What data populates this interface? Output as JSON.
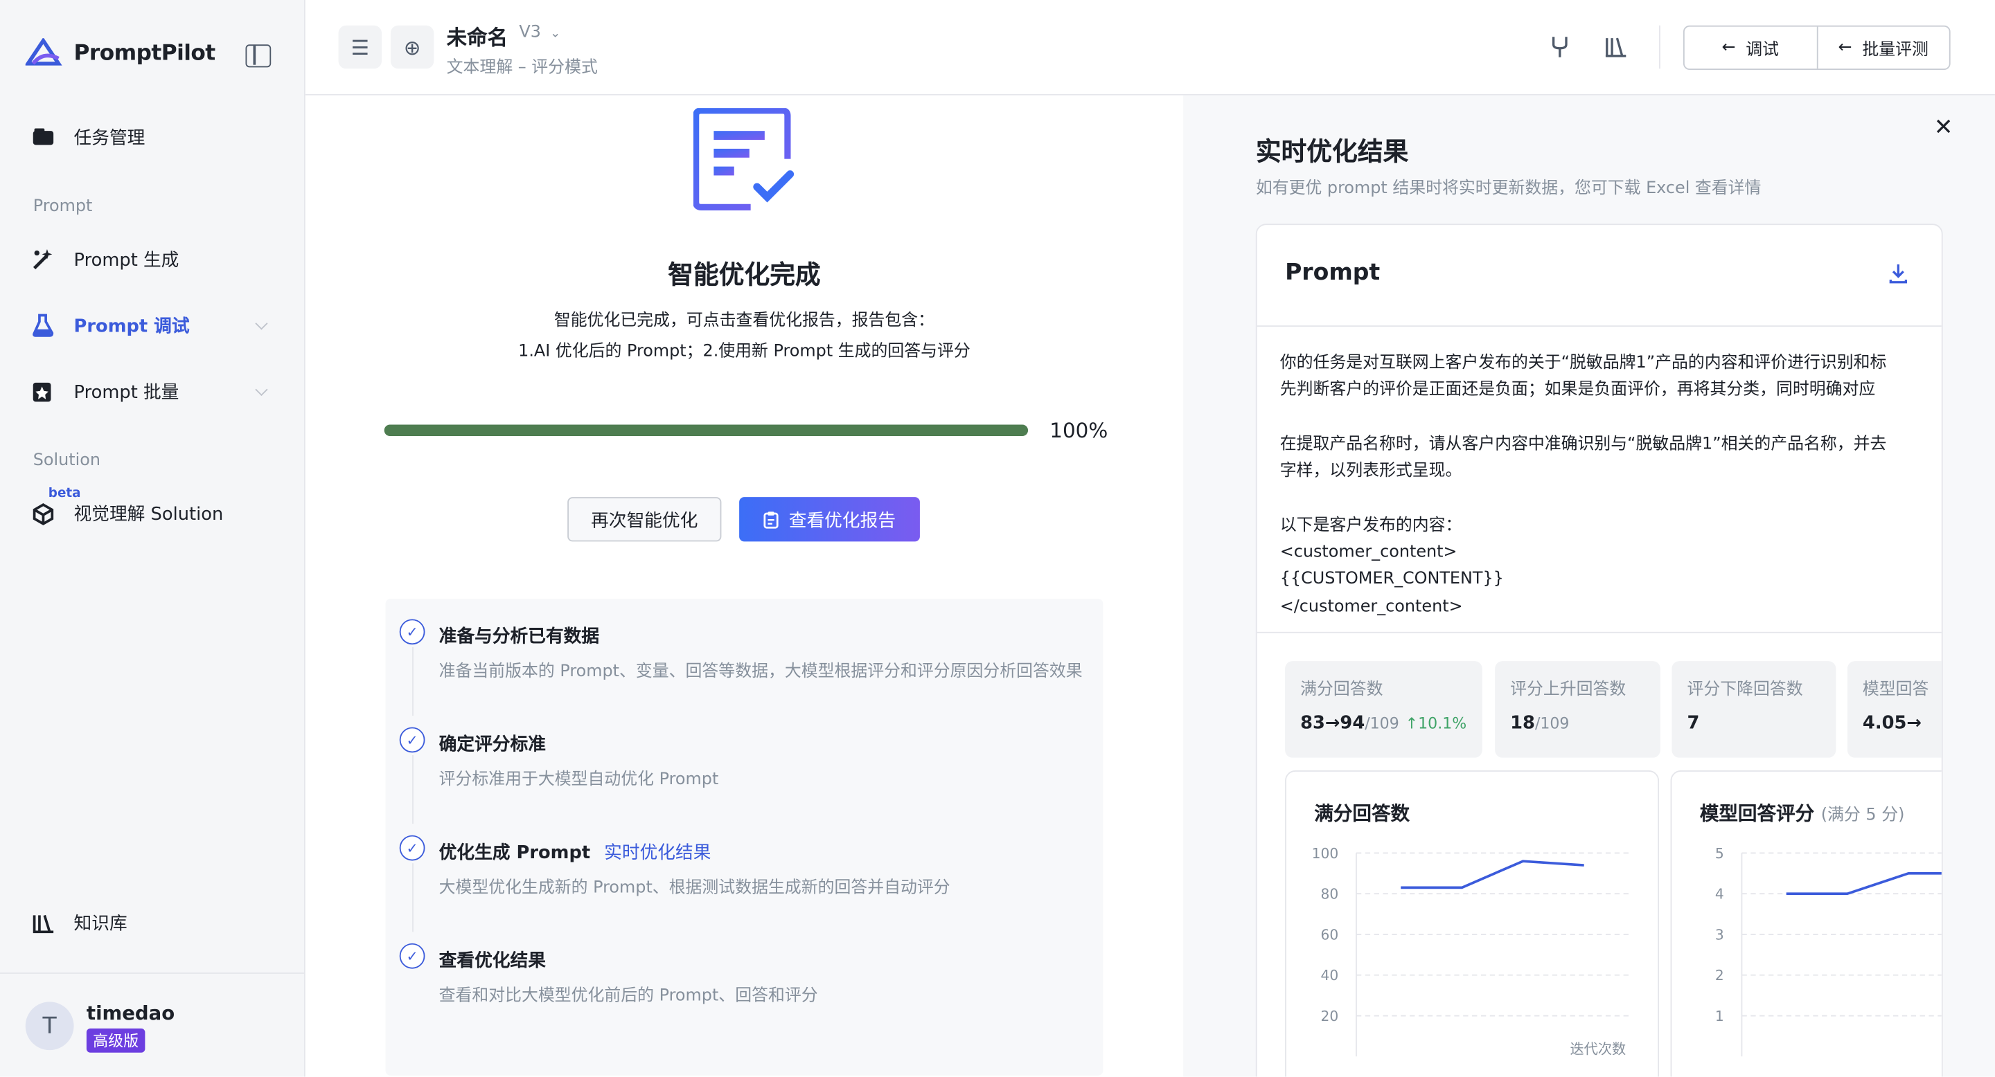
{
  "app": {
    "name": "PromptPilot"
  },
  "sidebar": {
    "items": [
      {
        "label": "任务管理"
      },
      {
        "label": "Prompt 生成"
      },
      {
        "label": "Prompt 调试"
      },
      {
        "label": "Prompt 批量"
      },
      {
        "label": "视觉理解 Solution"
      },
      {
        "label": "知识库"
      }
    ],
    "section_prompt": "Prompt",
    "section_solution": "Solution",
    "beta": "beta",
    "active_color": "#3b5bdb"
  },
  "user": {
    "initial": "T",
    "name": "timedao",
    "plan": "高级版"
  },
  "header": {
    "title": "未命名",
    "version": "V3",
    "subtitle": "文本理解 – 评分模式",
    "debug_label": "调试",
    "batch_label": "批量评测"
  },
  "center": {
    "title": "智能优化完成",
    "desc_line1": "智能优化已完成，可点击查看优化报告，报告包含：",
    "desc_line2": "1.AI 优化后的 Prompt；2.使用新 Prompt 生成的回答与评分",
    "progress": 100,
    "progress_label": "100%",
    "progress_color": "#4e7d50",
    "reoptimize_label": "再次智能优化",
    "view_report_label": "查看优化报告",
    "steps": [
      {
        "title": "准备与分析已有数据",
        "desc": "准备当前版本的 Prompt、变量、回答等数据，大模型根据评分和评分原因分析回答效果"
      },
      {
        "title": "确定评分标准",
        "desc": "评分标准用于大模型自动优化 Prompt"
      },
      {
        "title": "优化生成 Prompt",
        "link": "实时优化结果",
        "desc": "大模型优化生成新的 Prompt、根据测试数据生成新的回答并自动评分"
      },
      {
        "title": "查看优化结果",
        "desc": "查看和对比大模型优化前后的 Prompt、回答和评分"
      }
    ]
  },
  "right": {
    "title": "实时优化结果",
    "subtitle": "如有更优 prompt 结果时将实时更新数据，您可下载 Excel 查看详情",
    "card_title": "Prompt",
    "prompt_text": "你的任务是对互联网上客户发布的关于“脱敏品牌1”产品的内容和评价进行识别和标\n先判断客户的评价是正面还是负面；如果是负面评价，再将其分类，同时明确对应\n\n在提取产品名称时，请从客户内容中准确识别与“脱敏品牌1”相关的产品名称，并去\n字样，以列表形式呈现。\n\n以下是客户发布的内容：\n<customer_content>\n{{CUSTOMER_CONTENT}}\n</customer_content>",
    "stats": [
      {
        "label": "满分回答数",
        "value": "83→94",
        "total": "/109",
        "delta": "↑10.1%"
      },
      {
        "label": "评分上升回答数",
        "value": "18",
        "total": "/109"
      },
      {
        "label": "评分下降回答数",
        "value": "7"
      },
      {
        "label": "模型回答",
        "value": "4.05→"
      }
    ]
  },
  "chart_data": [
    {
      "type": "line",
      "title": "满分回答数",
      "xlabel": "迭代次数",
      "yticks": [
        100,
        80,
        60,
        40,
        20
      ],
      "ylim": [
        0,
        100
      ],
      "x": [
        1,
        2,
        3,
        4
      ],
      "values": [
        83,
        83,
        96,
        94
      ],
      "color": "#3b5bdb"
    },
    {
      "type": "line",
      "title": "模型回答评分",
      "title_note": "(满分 5 分)",
      "yticks": [
        5,
        4,
        3,
        2,
        1
      ],
      "ylim": [
        0,
        5
      ],
      "x": [
        1,
        2,
        3,
        4
      ],
      "values": [
        4.0,
        4.0,
        4.5,
        4.5
      ],
      "color": "#3b5bdb"
    }
  ]
}
